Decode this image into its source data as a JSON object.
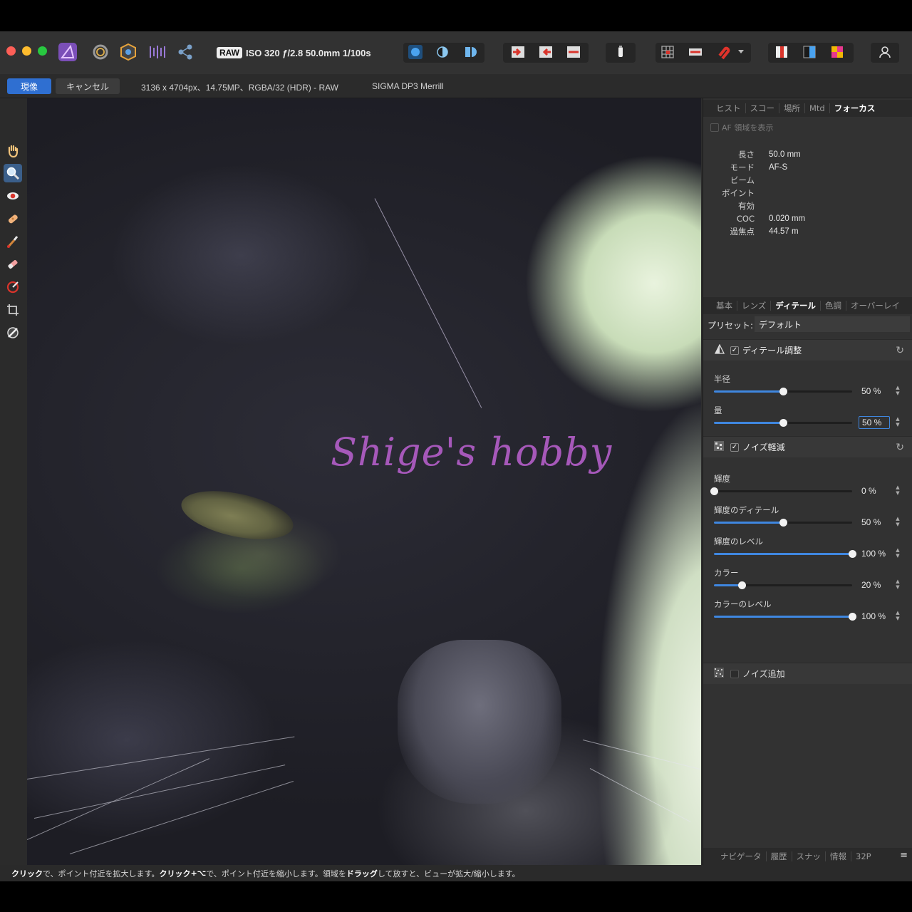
{
  "toolbar": {
    "raw_badge": "RAW",
    "exif": "ISO 320 ƒ/2.8 50.0mm 1/100s"
  },
  "context": {
    "develop_label": "現像",
    "cancel_label": "キャンセル",
    "image_info": "3136 x 4704px、14.75MP、RGBA/32 (HDR) - RAW",
    "camera": "SIGMA DP3 Merrill"
  },
  "canvas": {
    "watermark": "Shige's hobby"
  },
  "panel": {
    "top_tabs": [
      "ヒスト",
      "スコー",
      "場所",
      "Mtd",
      "フォーカス"
    ],
    "show_af_label": "AF 領域を表示",
    "focus": [
      {
        "label": "長さ",
        "value": "50.0 mm"
      },
      {
        "label": "モード",
        "value": "AF-S"
      },
      {
        "label": "ビーム",
        "value": ""
      },
      {
        "label": "ポイント",
        "value": ""
      },
      {
        "label": "有効",
        "value": ""
      },
      {
        "label": "COC",
        "value": "0.020 mm"
      },
      {
        "label": "過焦点",
        "value": "44.57 m"
      }
    ],
    "develop_tabs": [
      "基本",
      "レンズ",
      "ディテール",
      "色調",
      "オーバーレイ"
    ],
    "preset_label": "プリセット:",
    "preset_value": "デフォルト",
    "detail_section": "ディテール調整",
    "detail_sliders": [
      {
        "label": "半径",
        "value": "50 %",
        "fraction": 0.5
      },
      {
        "label": "量",
        "value": "50 %",
        "fraction": 0.5
      }
    ],
    "noise_section": "ノイズ軽減",
    "noise_sliders": [
      {
        "label": "輝度",
        "value": "0 %",
        "fraction": 0.0
      },
      {
        "label": "輝度のディテール",
        "value": "50 %",
        "fraction": 0.5
      },
      {
        "label": "輝度のレベル",
        "value": "100 %",
        "fraction": 1.0
      },
      {
        "label": "カラー",
        "value": "20 %",
        "fraction": 0.2
      },
      {
        "label": "カラーのレベル",
        "value": "100 %",
        "fraction": 1.0
      }
    ],
    "add_noise_section": "ノイズ追加",
    "bottom_tabs": [
      "ナビゲータ",
      "履歴",
      "スナッ",
      "情報",
      "32P"
    ]
  },
  "status": {
    "click1": "クリック",
    "t1": "で、ポイント付近を拡大します。",
    "click2": "クリック",
    "key": "+⌥",
    "t2": "で、ポイント付近を縮小します。領域を",
    "drag": "ドラッグ",
    "t3": "して放すと、ビューが拡大/縮小します。"
  },
  "colors": {
    "accent": "#3f87e0",
    "develop_button": "#2f6fd1",
    "watermark": "#b45ec9"
  }
}
